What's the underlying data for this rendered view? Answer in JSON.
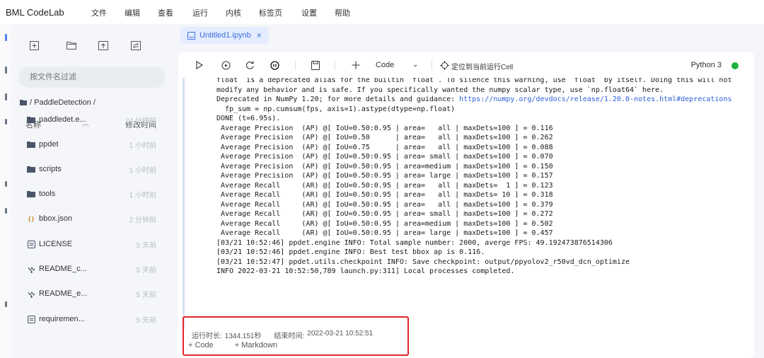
{
  "app": {
    "title": "BML CodeLab"
  },
  "menu": [
    "文件",
    "编辑",
    "查看",
    "运行",
    "内核",
    "标签页",
    "设置",
    "帮助"
  ],
  "sidebar": {
    "search_placeholder": "按文件名过滤",
    "path": "/ PaddleDetection /",
    "col_name": "名称",
    "col_time": "修改时间",
    "files": [
      {
        "name": "paddledet.e...",
        "time": "24 分钟前",
        "icon": "folder-icon"
      },
      {
        "name": "ppdet",
        "time": "1 小时前",
        "icon": "folder-icon"
      },
      {
        "name": "scripts",
        "time": "1 小时前",
        "icon": "folder-icon"
      },
      {
        "name": "tools",
        "time": "1 小时前",
        "icon": "folder-icon"
      },
      {
        "name": "bbox.json",
        "time": "2 分钟前",
        "icon": "json-file-icon"
      },
      {
        "name": "LICENSE",
        "time": "5 天前",
        "icon": "text-file-icon"
      },
      {
        "name": "README_c...",
        "time": "5 天前",
        "icon": "markdown-file-icon"
      },
      {
        "name": "README_e...",
        "time": "5 天前",
        "icon": "markdown-file-icon"
      },
      {
        "name": "requiremen...",
        "time": "5 天前",
        "icon": "text-file-icon"
      }
    ]
  },
  "tab": {
    "label": "Untitled1.ipynb"
  },
  "toolbar": {
    "cell_type": "Code",
    "locate_label": "定位到当前运行Cell",
    "kernel": "Python 3",
    "kernel_status_color": "#21b23c"
  },
  "output": {
    "lines": [
      "float` is a deprecated alias for the builtin `float`. To silence this warning, use `float` by itself. Doing this will not",
      "modify any behavior and is safe. If you specifically wanted the numpy scalar type, use `np.float64` here.",
      "Deprecated in NumPy 1.20; for more details and guidance: https://numpy.org/devdocs/release/1.20.0-notes.html#deprecations",
      "  fp_sum = np.cumsum(fps, axis=1).astype(dtype=np.float)",
      "DONE (t=6.95s).",
      " Average Precision  (AP) @[ IoU=0.50:0.95 | area=   all | maxDets=100 ] = 0.116",
      " Average Precision  (AP) @[ IoU=0.50      | area=   all | maxDets=100 ] = 0.262",
      " Average Precision  (AP) @[ IoU=0.75      | area=   all | maxDets=100 ] = 0.088",
      " Average Precision  (AP) @[ IoU=0.50:0.95 | area= small | maxDets=100 ] = 0.070",
      " Average Precision  (AP) @[ IoU=0.50:0.95 | area=medium | maxDets=100 ] = 0.150",
      " Average Precision  (AP) @[ IoU=0.50:0.95 | area= large | maxDets=100 ] = 0.157",
      " Average Recall     (AR) @[ IoU=0.50:0.95 | area=   all | maxDets=  1 ] = 0.123",
      " Average Recall     (AR) @[ IoU=0.50:0.95 | area=   all | maxDets= 10 ] = 0.318",
      " Average Recall     (AR) @[ IoU=0.50:0.95 | area=   all | maxDets=100 ] = 0.379",
      " Average Recall     (AR) @[ IoU=0.50:0.95 | area= small | maxDets=100 ] = 0.272",
      " Average Recall     (AR) @[ IoU=0.50:0.95 | area=medium | maxDets=100 ] = 0.502",
      " Average Recall     (AR) @[ IoU=0.50:0.95 | area= large | maxDets=100 ] = 0.457",
      "[03/21 10:52:46] ppdet.engine INFO: Total sample number: 2000, averge FPS: 49.192473876514306",
      "[03/21 10:52:46] ppdet.engine INFO: Best test bbox ap is 0.116.",
      "[03/21 10:52:47] ppdet.utils.checkpoint INFO: Save checkpoint: output/ppyolov2_r50vd_dcn_optimize",
      "INFO 2022-03-21 10:52:50,789 launch.py:311] Local processes completed."
    ],
    "link_text": "https://numpy.org/devdocs/release/1.20.0-notes.html#deprecations"
  },
  "cell": {
    "duration_label": "运行时长:",
    "duration": "1344.151秒",
    "end_label": "结束时间:",
    "end_time": "2022-03-21 10:52:51",
    "add_code": "+ Code",
    "add_markdown": "+ Markdown",
    "highlight_color": "#e5232d"
  }
}
